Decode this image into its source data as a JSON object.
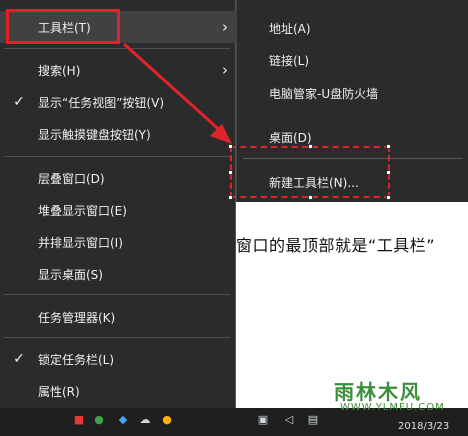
{
  "menu": {
    "items": [
      {
        "label": "工具栏(T)",
        "checked": false,
        "submenu": true
      },
      {
        "label": "搜索(H)",
        "checked": false,
        "submenu": true
      },
      {
        "label": "显示“任务视图”按钮(V)",
        "checked": true,
        "submenu": false
      },
      {
        "label": "显示触摸键盘按钮(Y)",
        "checked": false,
        "submenu": false
      },
      {
        "label": "层叠窗口(D)",
        "checked": false,
        "submenu": false
      },
      {
        "label": "堆叠显示窗口(E)",
        "checked": false,
        "submenu": false
      },
      {
        "label": "并排显示窗口(I)",
        "checked": false,
        "submenu": false
      },
      {
        "label": "显示桌面(S)",
        "checked": false,
        "submenu": false
      },
      {
        "label": "任务管理器(K)",
        "checked": false,
        "submenu": false
      },
      {
        "label": "锁定任务栏(L)",
        "checked": true,
        "submenu": false
      },
      {
        "label": "属性(R)",
        "checked": false,
        "submenu": false
      }
    ],
    "check_glyph": "✓",
    "arrow_glyph": "›"
  },
  "submenu": {
    "items": [
      {
        "label": "地址(A)"
      },
      {
        "label": "链接(L)"
      },
      {
        "label": "电脑管家-U盘防火墙"
      },
      {
        "label": "桌面(D)"
      },
      {
        "label": "新建工具栏(N)..."
      }
    ]
  },
  "background": {
    "article_text": "窗口的最顶部就是“工具栏”"
  },
  "watermark": {
    "main": "雨林木风",
    "sub": "WWW.YLMFU.COM"
  },
  "taskbar": {
    "date": "2018/3/23"
  },
  "colors": {
    "menu_bg": "#2b2b2b",
    "menu_text": "#f0f0f0",
    "highlight": "#e0232a"
  }
}
